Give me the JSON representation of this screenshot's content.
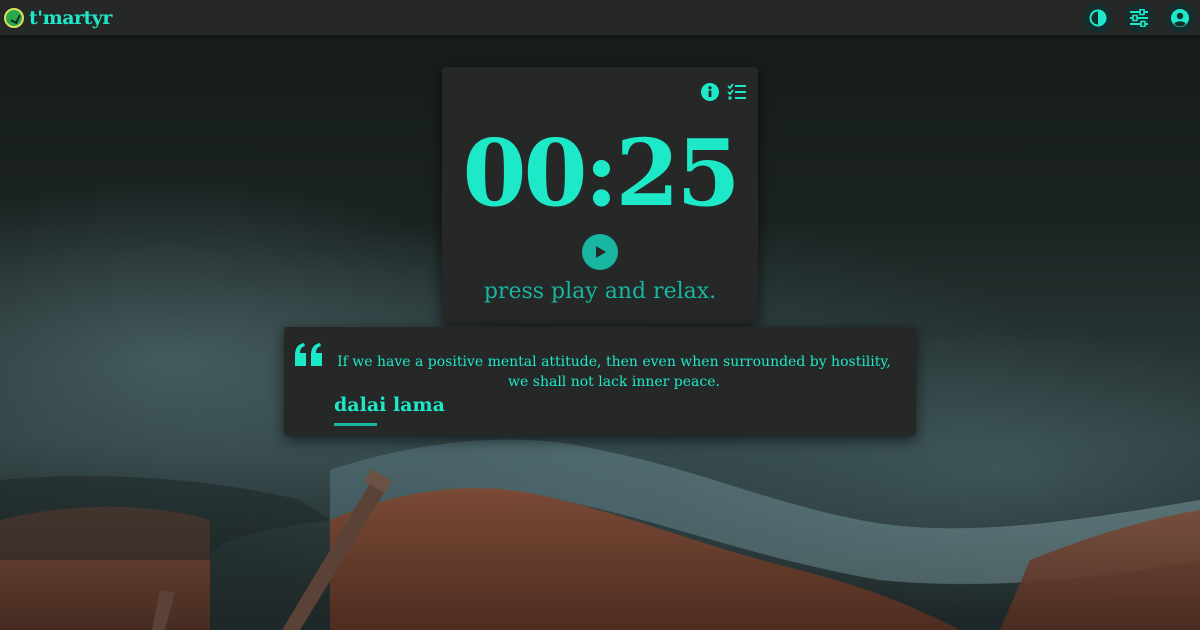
{
  "app": {
    "brand_name": "t'martyr",
    "accent_color": "#1de9c9",
    "dark_accent": "#17b6a1",
    "panel_color": "#262727"
  },
  "topbar": {
    "buttons": [
      {
        "icon": "theme-contrast-icon"
      },
      {
        "icon": "settings-sliders-icon"
      },
      {
        "icon": "user-account-icon"
      }
    ]
  },
  "timer": {
    "time": "00:25",
    "message": "press play and relax.",
    "icons": [
      "info-icon",
      "task-checklist-icon",
      "play-icon"
    ]
  },
  "quote": {
    "text": "If we have a positive mental attitude, then even when surrounded by hostility, we shall not lack inner peace.",
    "author": "dalai lama",
    "icon": "quote-mark-icon"
  }
}
